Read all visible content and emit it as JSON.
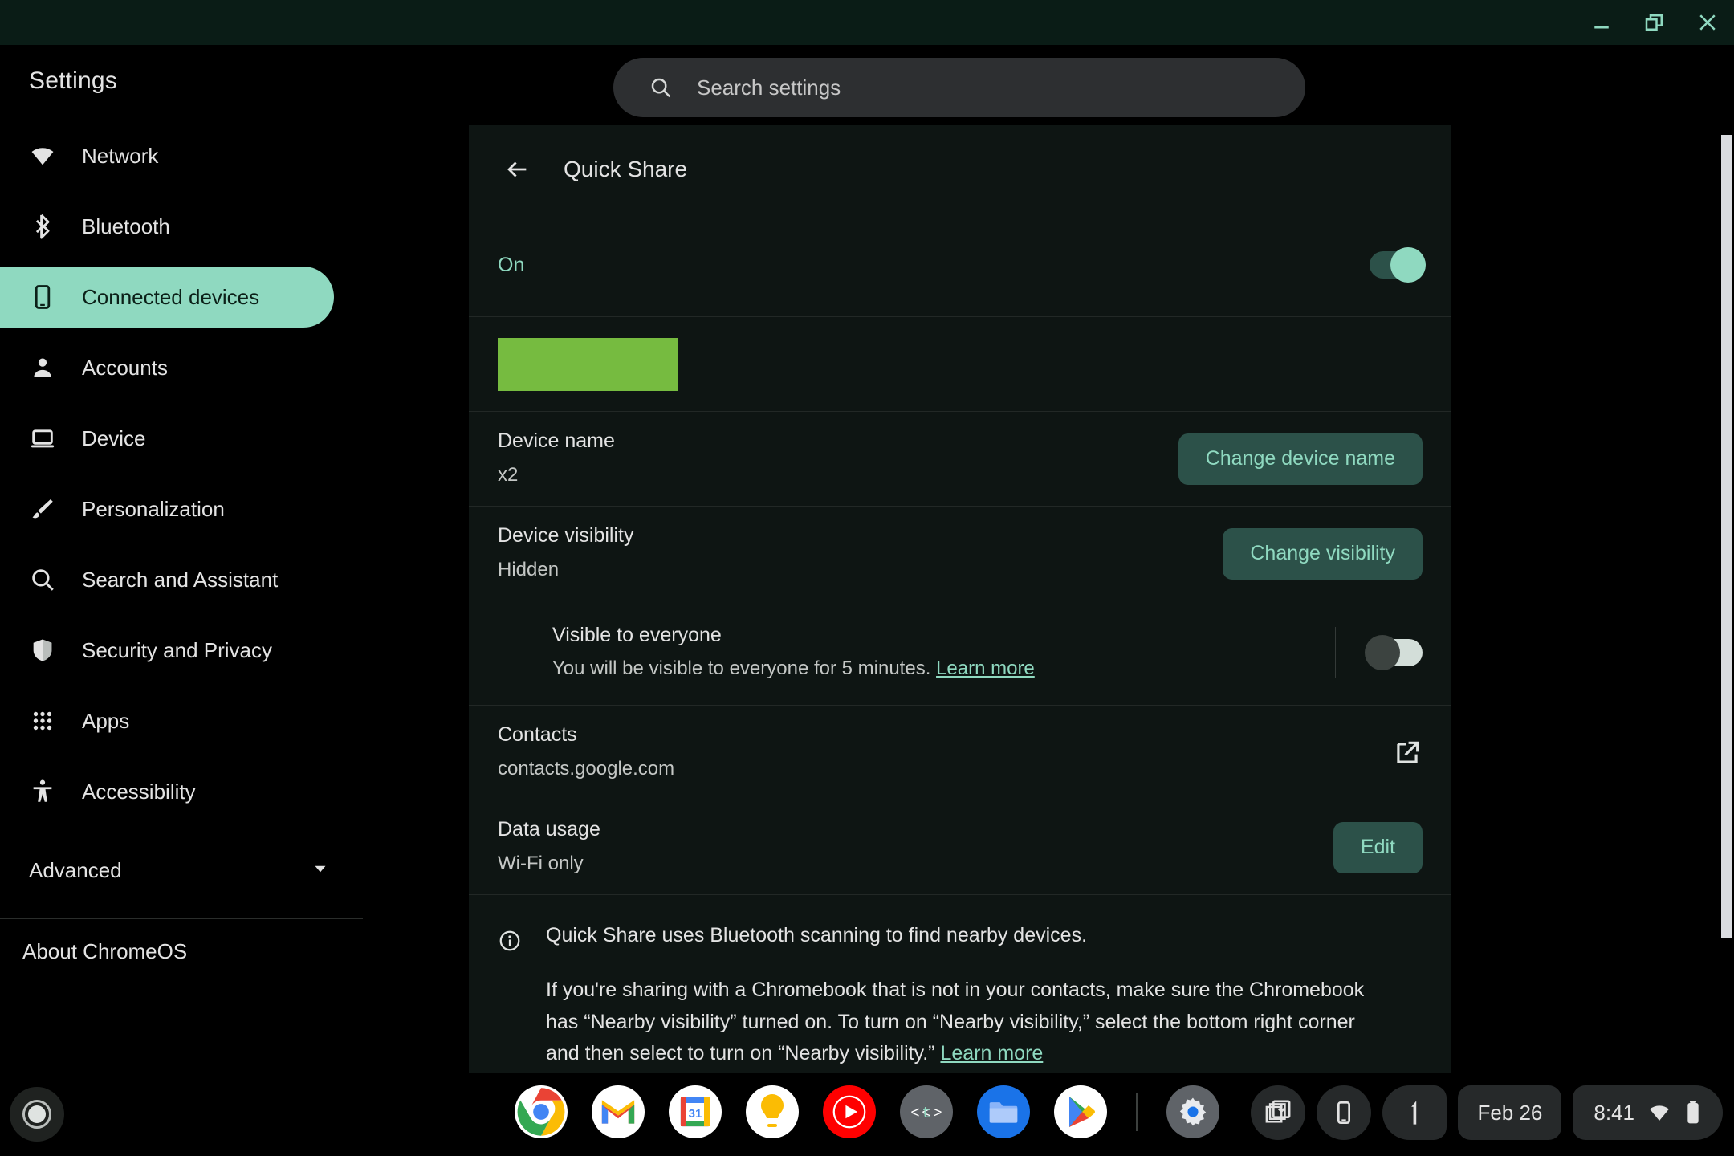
{
  "window_controls": {
    "minimize": "minimize-icon",
    "restore": "restore-icon",
    "close": "close-icon"
  },
  "topbar": {
    "brand": "Settings",
    "search": {
      "placeholder": "Search settings",
      "value": "",
      "icon": "search-icon"
    }
  },
  "sidebar": {
    "items": [
      {
        "label": "Network",
        "icon": "wifi-icon",
        "selected": false
      },
      {
        "label": "Bluetooth",
        "icon": "bluetooth-icon",
        "selected": false
      },
      {
        "label": "Connected devices",
        "icon": "phone-icon",
        "selected": true
      },
      {
        "label": "Accounts",
        "icon": "person-icon",
        "selected": false
      },
      {
        "label": "Device",
        "icon": "laptop-icon",
        "selected": false
      },
      {
        "label": "Personalization",
        "icon": "brush-icon",
        "selected": false
      },
      {
        "label": "Search and Assistant",
        "icon": "search-icon",
        "selected": false
      },
      {
        "label": "Security and Privacy",
        "icon": "shield-icon",
        "selected": false
      },
      {
        "label": "Apps",
        "icon": "grid-apps-icon",
        "selected": false
      },
      {
        "label": "Accessibility",
        "icon": "accessibility-icon",
        "selected": false
      }
    ],
    "advanced": {
      "label": "Advanced",
      "icon": "chevron-down-icon"
    },
    "about": {
      "label": "About ChromeOS"
    }
  },
  "page": {
    "back_icon": "arrow-left-icon",
    "title": "Quick Share",
    "enable_row": {
      "state_label": "On",
      "toggle_on": true
    },
    "device_name": {
      "title": "Device name",
      "value": "x2",
      "button": "Change device name"
    },
    "device_visibility": {
      "title": "Device visibility",
      "value": "Hidden",
      "button": "Change visibility"
    },
    "visible_to_everyone": {
      "title": "Visible to everyone",
      "description": "You will be visible to everyone for 5 minutes.",
      "link": "Learn more",
      "toggle_on": false
    },
    "contacts": {
      "title": "Contacts",
      "value": "contacts.google.com",
      "icon": "external-link-icon"
    },
    "data_usage": {
      "title": "Data usage",
      "value": "Wi-Fi only",
      "button": "Edit"
    },
    "info": {
      "icon": "info-icon",
      "line1": "Quick Share uses Bluetooth scanning to find nearby devices.",
      "paragraph": "If you're sharing with a Chromebook that is not in your contacts, make sure the Chromebook has “Nearby visibility” turned on. To turn on “Nearby visibility,” select the bottom right corner and then select to turn on “Nearby visibility.”",
      "link": "Learn more"
    }
  },
  "colors": {
    "accent_teal": "#8fd9c0",
    "button_bg": "#2c5149",
    "selected_nav_bg": "#8fd9c0",
    "placeholder_green": "#76bb40",
    "card_bg": "#0e1513",
    "titlebar_bg": "#0a1c16"
  },
  "shelf": {
    "launcher": "launcher-button",
    "apps": [
      {
        "name": "chrome-app",
        "label": "Chrome"
      },
      {
        "name": "gmail-app",
        "label": "Gmail"
      },
      {
        "name": "calendar-app",
        "label": "Calendar"
      },
      {
        "name": "keep-app",
        "label": "Keep"
      },
      {
        "name": "youtube-music-app",
        "label": "YouTube Music"
      },
      {
        "name": "terminal-app",
        "label": "Terminal"
      },
      {
        "name": "files-app",
        "label": "Files"
      },
      {
        "name": "play-store-app",
        "label": "Play Store"
      },
      {
        "name": "settings-app",
        "label": "Settings"
      }
    ],
    "status": {
      "screen_capture_icon": "screen-capture-icon",
      "phone_hub_icon": "phone-hub-icon",
      "notification_icon": "notification-icon",
      "date": "Feb 26",
      "time": "8:41",
      "network_icon": "wifi-icon",
      "battery_icon": "battery-icon"
    }
  }
}
